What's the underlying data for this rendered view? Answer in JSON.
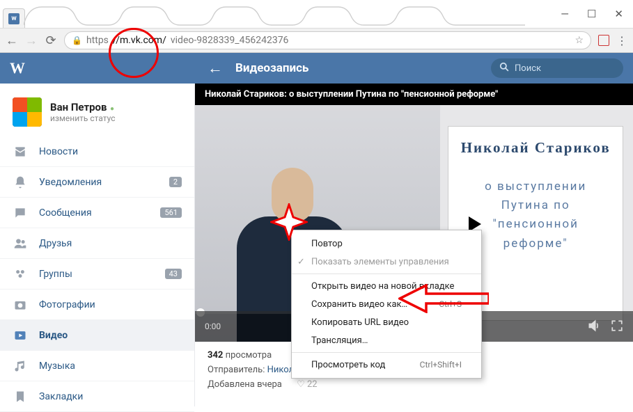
{
  "window": {
    "minimize": "—",
    "maximize": "☐",
    "close": "✕"
  },
  "browser": {
    "url_scheme": "https",
    "url_host": "//m.vk.com/",
    "url_path": "video-9828339_456242376"
  },
  "vk": {
    "back": "←",
    "page_title": "Видеозапись",
    "search_placeholder": "Поиск"
  },
  "profile": {
    "name": "Ван Петров",
    "status": "изменить статус"
  },
  "nav": [
    {
      "icon": "news",
      "label": "Новости",
      "badge": null
    },
    {
      "icon": "bell",
      "label": "Уведомления",
      "badge": "2"
    },
    {
      "icon": "msg",
      "label": "Сообщения",
      "badge": "561"
    },
    {
      "icon": "friends",
      "label": "Друзья",
      "badge": null
    },
    {
      "icon": "groups",
      "label": "Группы",
      "badge": "43"
    },
    {
      "icon": "photo",
      "label": "Фотографии",
      "badge": null
    },
    {
      "icon": "video",
      "label": "Видео",
      "badge": null,
      "active": true
    },
    {
      "icon": "music",
      "label": "Музыка",
      "badge": null
    },
    {
      "icon": "bookmark",
      "label": "Закладки",
      "badge": null
    }
  ],
  "video": {
    "title": "Николай Стариков: о выступлении Путина по \"пенсионной реформе\"",
    "card_name": "Николай Стариков",
    "card_desc1": "о выступлении",
    "card_desc2": "Путина по",
    "card_desc3": "\"пенсионной",
    "card_desc4": "реформе\"",
    "time": "0:00",
    "views_num": "342",
    "views_label": " просмотра",
    "sender_label": "Отправитель: ",
    "sender": "Николай Стариков (официальная страница)",
    "added": "Добавлена вчера",
    "likes": "22"
  },
  "ctx": {
    "repeat": "Повтор",
    "controls": "Показать элементы управления",
    "open_new": "Открыть видео на новой вкладке",
    "save_as": "Сохранить видео как…",
    "save_sc": "Ctrl+S",
    "copy_url": "Копировать URL видео",
    "cast": "Трансляция…",
    "inspect": "Просмотреть код",
    "inspect_sc": "Ctrl+Shift+I"
  }
}
